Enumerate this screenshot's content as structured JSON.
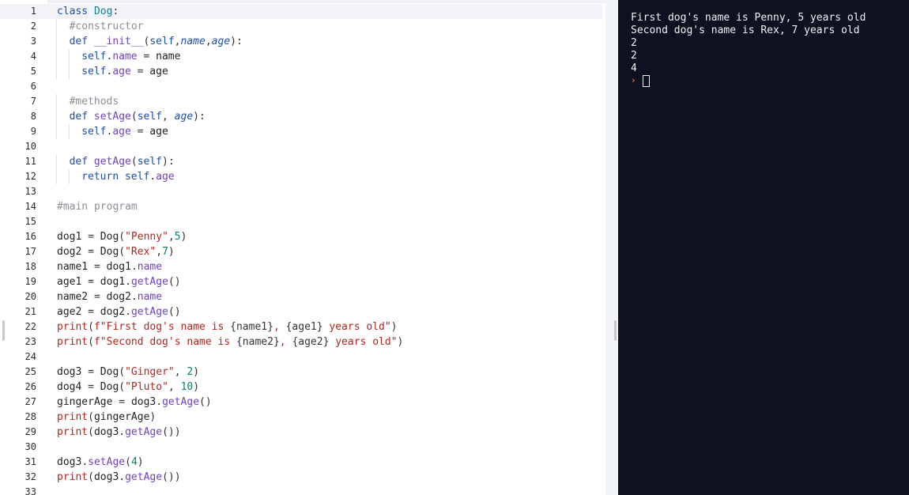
{
  "editor": {
    "active_line": 1,
    "lines": [
      {
        "n": "1",
        "indent": 0,
        "tokens": [
          [
            "kw",
            "class"
          ],
          [
            "id",
            " "
          ],
          [
            "cls",
            "Dog"
          ],
          [
            "op",
            ":"
          ]
        ]
      },
      {
        "n": "2",
        "indent": 1,
        "tokens": [
          [
            "cmt",
            "#constructor"
          ]
        ]
      },
      {
        "n": "3",
        "indent": 1,
        "tokens": [
          [
            "kw",
            "def"
          ],
          [
            "id",
            " "
          ],
          [
            "fn",
            "__init__"
          ],
          [
            "op",
            "("
          ],
          [
            "self",
            "self"
          ],
          [
            "op",
            ","
          ],
          [
            "param",
            "name"
          ],
          [
            "op",
            ","
          ],
          [
            "param",
            "age"
          ],
          [
            "op",
            "):"
          ]
        ]
      },
      {
        "n": "4",
        "indent": 2,
        "tokens": [
          [
            "self",
            "self"
          ],
          [
            "op",
            "."
          ],
          [
            "attr",
            "name"
          ],
          [
            "op",
            " = "
          ],
          [
            "id",
            "name"
          ]
        ]
      },
      {
        "n": "5",
        "indent": 2,
        "tokens": [
          [
            "self",
            "self"
          ],
          [
            "op",
            "."
          ],
          [
            "attr",
            "age"
          ],
          [
            "op",
            " = "
          ],
          [
            "id",
            "age"
          ]
        ]
      },
      {
        "n": "6",
        "indent": 0,
        "tokens": []
      },
      {
        "n": "7",
        "indent": 1,
        "tokens": [
          [
            "cmt",
            "#methods"
          ]
        ]
      },
      {
        "n": "8",
        "indent": 1,
        "tokens": [
          [
            "kw",
            "def"
          ],
          [
            "id",
            " "
          ],
          [
            "fn",
            "setAge"
          ],
          [
            "op",
            "("
          ],
          [
            "self",
            "self"
          ],
          [
            "op",
            ", "
          ],
          [
            "param",
            "age"
          ],
          [
            "op",
            "):"
          ]
        ]
      },
      {
        "n": "9",
        "indent": 2,
        "tokens": [
          [
            "self",
            "self"
          ],
          [
            "op",
            "."
          ],
          [
            "attr",
            "age"
          ],
          [
            "op",
            " = "
          ],
          [
            "id",
            "age"
          ]
        ]
      },
      {
        "n": "10",
        "indent": 0,
        "tokens": []
      },
      {
        "n": "11",
        "indent": 1,
        "tokens": [
          [
            "kw",
            "def"
          ],
          [
            "id",
            " "
          ],
          [
            "fn",
            "getAge"
          ],
          [
            "op",
            "("
          ],
          [
            "self",
            "self"
          ],
          [
            "op",
            "):"
          ]
        ]
      },
      {
        "n": "12",
        "indent": 2,
        "tokens": [
          [
            "kw",
            "return"
          ],
          [
            "id",
            " "
          ],
          [
            "self",
            "self"
          ],
          [
            "op",
            "."
          ],
          [
            "attr",
            "age"
          ]
        ]
      },
      {
        "n": "13",
        "indent": 0,
        "tokens": []
      },
      {
        "n": "14",
        "indent": 0,
        "tokens": [
          [
            "cmt",
            "#main program"
          ]
        ]
      },
      {
        "n": "15",
        "indent": 0,
        "tokens": []
      },
      {
        "n": "16",
        "indent": 0,
        "tokens": [
          [
            "id",
            "dog1"
          ],
          [
            "op",
            " = "
          ],
          [
            "id",
            "Dog"
          ],
          [
            "op",
            "("
          ],
          [
            "str",
            "\"Penny\""
          ],
          [
            "op",
            ","
          ],
          [
            "num",
            "5"
          ],
          [
            "op",
            ")"
          ]
        ]
      },
      {
        "n": "17",
        "indent": 0,
        "tokens": [
          [
            "id",
            "dog2"
          ],
          [
            "op",
            " = "
          ],
          [
            "id",
            "Dog"
          ],
          [
            "op",
            "("
          ],
          [
            "str",
            "\"Rex\""
          ],
          [
            "op",
            ","
          ],
          [
            "num",
            "7"
          ],
          [
            "op",
            ")"
          ]
        ]
      },
      {
        "n": "18",
        "indent": 0,
        "tokens": [
          [
            "id",
            "name1"
          ],
          [
            "op",
            " = "
          ],
          [
            "id",
            "dog1"
          ],
          [
            "op",
            "."
          ],
          [
            "attr",
            "name"
          ]
        ]
      },
      {
        "n": "19",
        "indent": 0,
        "tokens": [
          [
            "id",
            "age1"
          ],
          [
            "op",
            " = "
          ],
          [
            "id",
            "dog1"
          ],
          [
            "op",
            "."
          ],
          [
            "attr",
            "getAge"
          ],
          [
            "op",
            "()"
          ]
        ]
      },
      {
        "n": "20",
        "indent": 0,
        "tokens": [
          [
            "id",
            "name2"
          ],
          [
            "op",
            " = "
          ],
          [
            "id",
            "dog2"
          ],
          [
            "op",
            "."
          ],
          [
            "attr",
            "name"
          ]
        ]
      },
      {
        "n": "21",
        "indent": 0,
        "tokens": [
          [
            "id",
            "age2"
          ],
          [
            "op",
            " = "
          ],
          [
            "id",
            "dog2"
          ],
          [
            "op",
            "."
          ],
          [
            "attr",
            "getAge"
          ],
          [
            "op",
            "()"
          ]
        ]
      },
      {
        "n": "22",
        "indent": 0,
        "tokens": [
          [
            "builtin",
            "print"
          ],
          [
            "op",
            "("
          ],
          [
            "str",
            "f\"First dog's name is "
          ],
          [
            "op",
            "{name1}"
          ],
          [
            "str",
            ", "
          ],
          [
            "op",
            "{age1}"
          ],
          [
            "str",
            " years old\""
          ],
          [
            "op",
            ")"
          ]
        ]
      },
      {
        "n": "23",
        "indent": 0,
        "tokens": [
          [
            "builtin",
            "print"
          ],
          [
            "op",
            "("
          ],
          [
            "str",
            "f\"Second dog's name is "
          ],
          [
            "op",
            "{name2}"
          ],
          [
            "str",
            ", "
          ],
          [
            "op",
            "{age2}"
          ],
          [
            "str",
            " years old\""
          ],
          [
            "op",
            ")"
          ]
        ]
      },
      {
        "n": "24",
        "indent": 0,
        "tokens": []
      },
      {
        "n": "25",
        "indent": 0,
        "tokens": [
          [
            "id",
            "dog3"
          ],
          [
            "op",
            " = "
          ],
          [
            "id",
            "Dog"
          ],
          [
            "op",
            "("
          ],
          [
            "str",
            "\"Ginger\""
          ],
          [
            "op",
            ", "
          ],
          [
            "num",
            "2"
          ],
          [
            "op",
            ")"
          ]
        ]
      },
      {
        "n": "26",
        "indent": 0,
        "tokens": [
          [
            "id",
            "dog4"
          ],
          [
            "op",
            " = "
          ],
          [
            "id",
            "Dog"
          ],
          [
            "op",
            "("
          ],
          [
            "str",
            "\"Pluto\""
          ],
          [
            "op",
            ", "
          ],
          [
            "num",
            "10"
          ],
          [
            "op",
            ")"
          ]
        ]
      },
      {
        "n": "27",
        "indent": 0,
        "tokens": [
          [
            "id",
            "gingerAge"
          ],
          [
            "op",
            " = "
          ],
          [
            "id",
            "dog3"
          ],
          [
            "op",
            "."
          ],
          [
            "attr",
            "getAge"
          ],
          [
            "op",
            "()"
          ]
        ]
      },
      {
        "n": "28",
        "indent": 0,
        "tokens": [
          [
            "builtin",
            "print"
          ],
          [
            "op",
            "("
          ],
          [
            "id",
            "gingerAge"
          ],
          [
            "op",
            ")"
          ]
        ]
      },
      {
        "n": "29",
        "indent": 0,
        "tokens": [
          [
            "builtin",
            "print"
          ],
          [
            "op",
            "("
          ],
          [
            "id",
            "dog3"
          ],
          [
            "op",
            "."
          ],
          [
            "attr",
            "getAge"
          ],
          [
            "op",
            "())"
          ]
        ]
      },
      {
        "n": "30",
        "indent": 0,
        "tokens": []
      },
      {
        "n": "31",
        "indent": 0,
        "tokens": [
          [
            "id",
            "dog3"
          ],
          [
            "op",
            "."
          ],
          [
            "attr",
            "setAge"
          ],
          [
            "op",
            "("
          ],
          [
            "num",
            "4"
          ],
          [
            "op",
            ")"
          ]
        ]
      },
      {
        "n": "32",
        "indent": 0,
        "tokens": [
          [
            "builtin",
            "print"
          ],
          [
            "op",
            "("
          ],
          [
            "id",
            "dog3"
          ],
          [
            "op",
            "."
          ],
          [
            "attr",
            "getAge"
          ],
          [
            "op",
            "())"
          ]
        ]
      },
      {
        "n": "33",
        "indent": 0,
        "tokens": []
      }
    ]
  },
  "console": {
    "output": [
      "First dog's name is Penny, 5 years old",
      "Second dog's name is Rex, 7 years old",
      "2",
      "2",
      "4"
    ],
    "prompt_symbol": "›"
  },
  "colors": {
    "console_background": "#0e1120",
    "console_text": "#f1f1f1",
    "prompt": "#ff7a3d",
    "keyword": "#1c4fa8",
    "string": "#b3261e",
    "number": "#0a7f6e",
    "comment": "#8a8f98",
    "method": "#6f42c1"
  }
}
